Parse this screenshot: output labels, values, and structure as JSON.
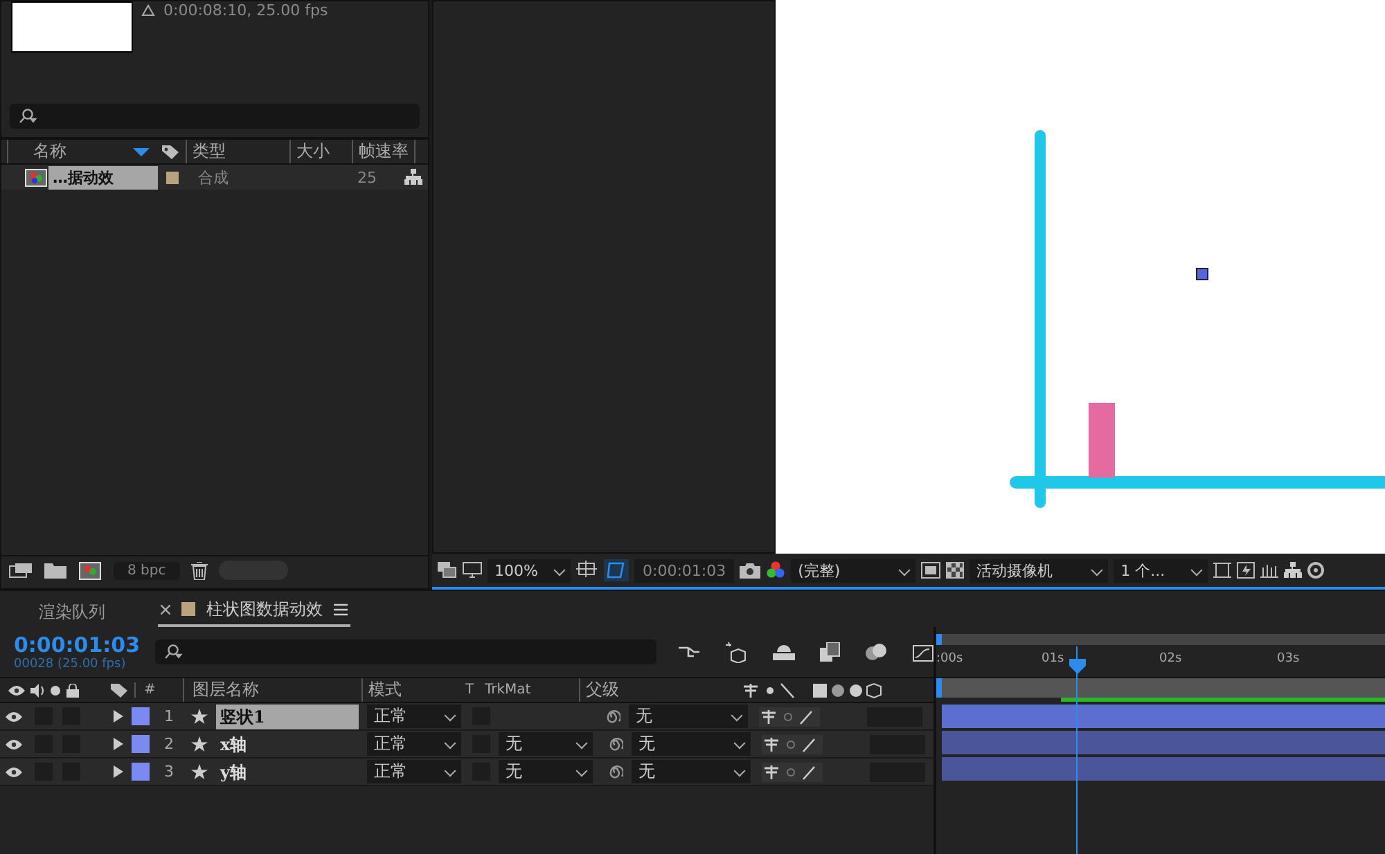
{
  "project": {
    "info": "0:00:08:10, 25.00 fps",
    "columns": [
      "名称",
      "类型",
      "大小",
      "帧速率"
    ],
    "items": [
      {
        "name": "…据动效",
        "type": "合成",
        "frame_rate": "25",
        "selected": true,
        "color": "#b9a37e"
      }
    ],
    "bpc": "8 bpc"
  },
  "viewer_toolbar": {
    "zoom": "100%",
    "timecode": "0:00:01:03",
    "resolution": "(完整)",
    "camera": "活动摄像机",
    "views": "1 个..."
  },
  "panel_tabs": [
    {
      "label": "渲染队列",
      "selected": false
    },
    {
      "label": "柱状图数据动效",
      "selected": true,
      "color": "#b9a37e"
    }
  ],
  "timeline": {
    "timecode": "0:00:01:03",
    "frames": "00028 (25.00 fps)",
    "columns": [
      "#",
      "图层名称",
      "模式",
      "T",
      "TrkMat",
      "父级"
    ],
    "layers": [
      {
        "number": "1",
        "name": "竖状1",
        "selected": true,
        "visible": true,
        "solo": false,
        "locked": false,
        "preserve_transparency": false,
        "mode": "正常",
        "parent": "无",
        "color": "#7b8af0"
      },
      {
        "number": "2",
        "name": "x轴",
        "selected": false,
        "visible": true,
        "solo": false,
        "locked": false,
        "preserve_transparency": false,
        "mode": "正常",
        "trkmat": "无",
        "parent": "无",
        "color": "#7b8af0"
      },
      {
        "number": "3",
        "name": "y轴",
        "selected": false,
        "visible": true,
        "solo": false,
        "locked": false,
        "preserve_transparency": false,
        "mode": "正常",
        "trkmat": "无",
        "parent": "无",
        "color": "#7b8af0"
      }
    ],
    "ruler": [
      ":00s",
      "01s",
      "02s",
      "03s"
    ]
  }
}
